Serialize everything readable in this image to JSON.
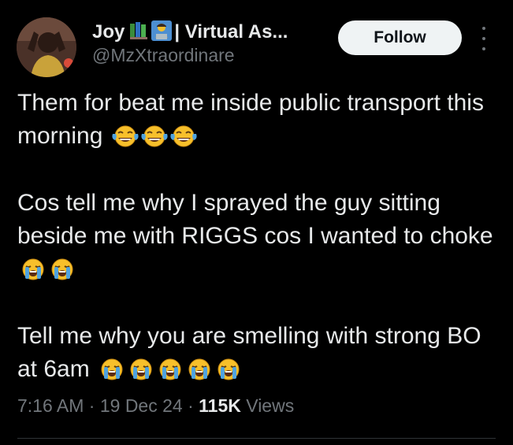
{
  "author": {
    "display_name": "Joy",
    "display_name_suffix": "| Virtual As...",
    "handle": "@MzXtraordinare",
    "name_emojis": [
      "books-emoji",
      "technologist-emoji"
    ]
  },
  "actions": {
    "follow_label": "Follow",
    "more_icon": "more-vertical-icon"
  },
  "tweet": {
    "paragraphs": [
      {
        "text": "Them for beat me inside public transport this morning",
        "emoji": "face-with-tears-of-joy",
        "emoji_count": 3
      },
      {
        "text": "Cos tell me why I sprayed the guy sitting beside me with RIGGS cos I wanted to choke",
        "emoji": "loudly-crying-face",
        "emoji_count": 2
      },
      {
        "text": "Tell me why you are smelling with strong BO at 6am",
        "emoji": "loudly-crying-face",
        "emoji_count": 5
      }
    ]
  },
  "meta": {
    "time": "7:16 AM",
    "separator": "·",
    "date": "19 Dec 24",
    "views_count": "115K",
    "views_label": "Views"
  },
  "colors": {
    "background": "#000000",
    "text": "#e7e9ea",
    "secondary": "#71767b",
    "button_bg": "#eff3f4",
    "emoji_yellow": "#f7c02b",
    "emoji_tear": "#4fa3e0"
  }
}
